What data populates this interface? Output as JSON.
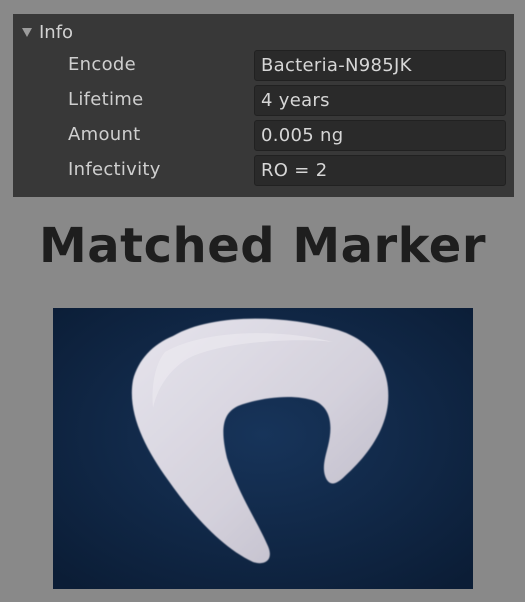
{
  "info": {
    "header_label": "Info",
    "rows": [
      {
        "label": "Encode",
        "value": "Bacteria-N985JK"
      },
      {
        "label": "Lifetime",
        "value": "4 years"
      },
      {
        "label": "Amount",
        "value": "0.005 ng"
      },
      {
        "label": "Infectivity",
        "value": "RO = 2"
      }
    ]
  },
  "headline": "Matched Marker",
  "colors": {
    "background": "#898989",
    "panel": "#383838",
    "field": "#2a2a2a",
    "marker_background": "#0f2645",
    "marker_shape": "#dcdae2"
  },
  "icons": {
    "foldout": "triangle-down-icon"
  }
}
